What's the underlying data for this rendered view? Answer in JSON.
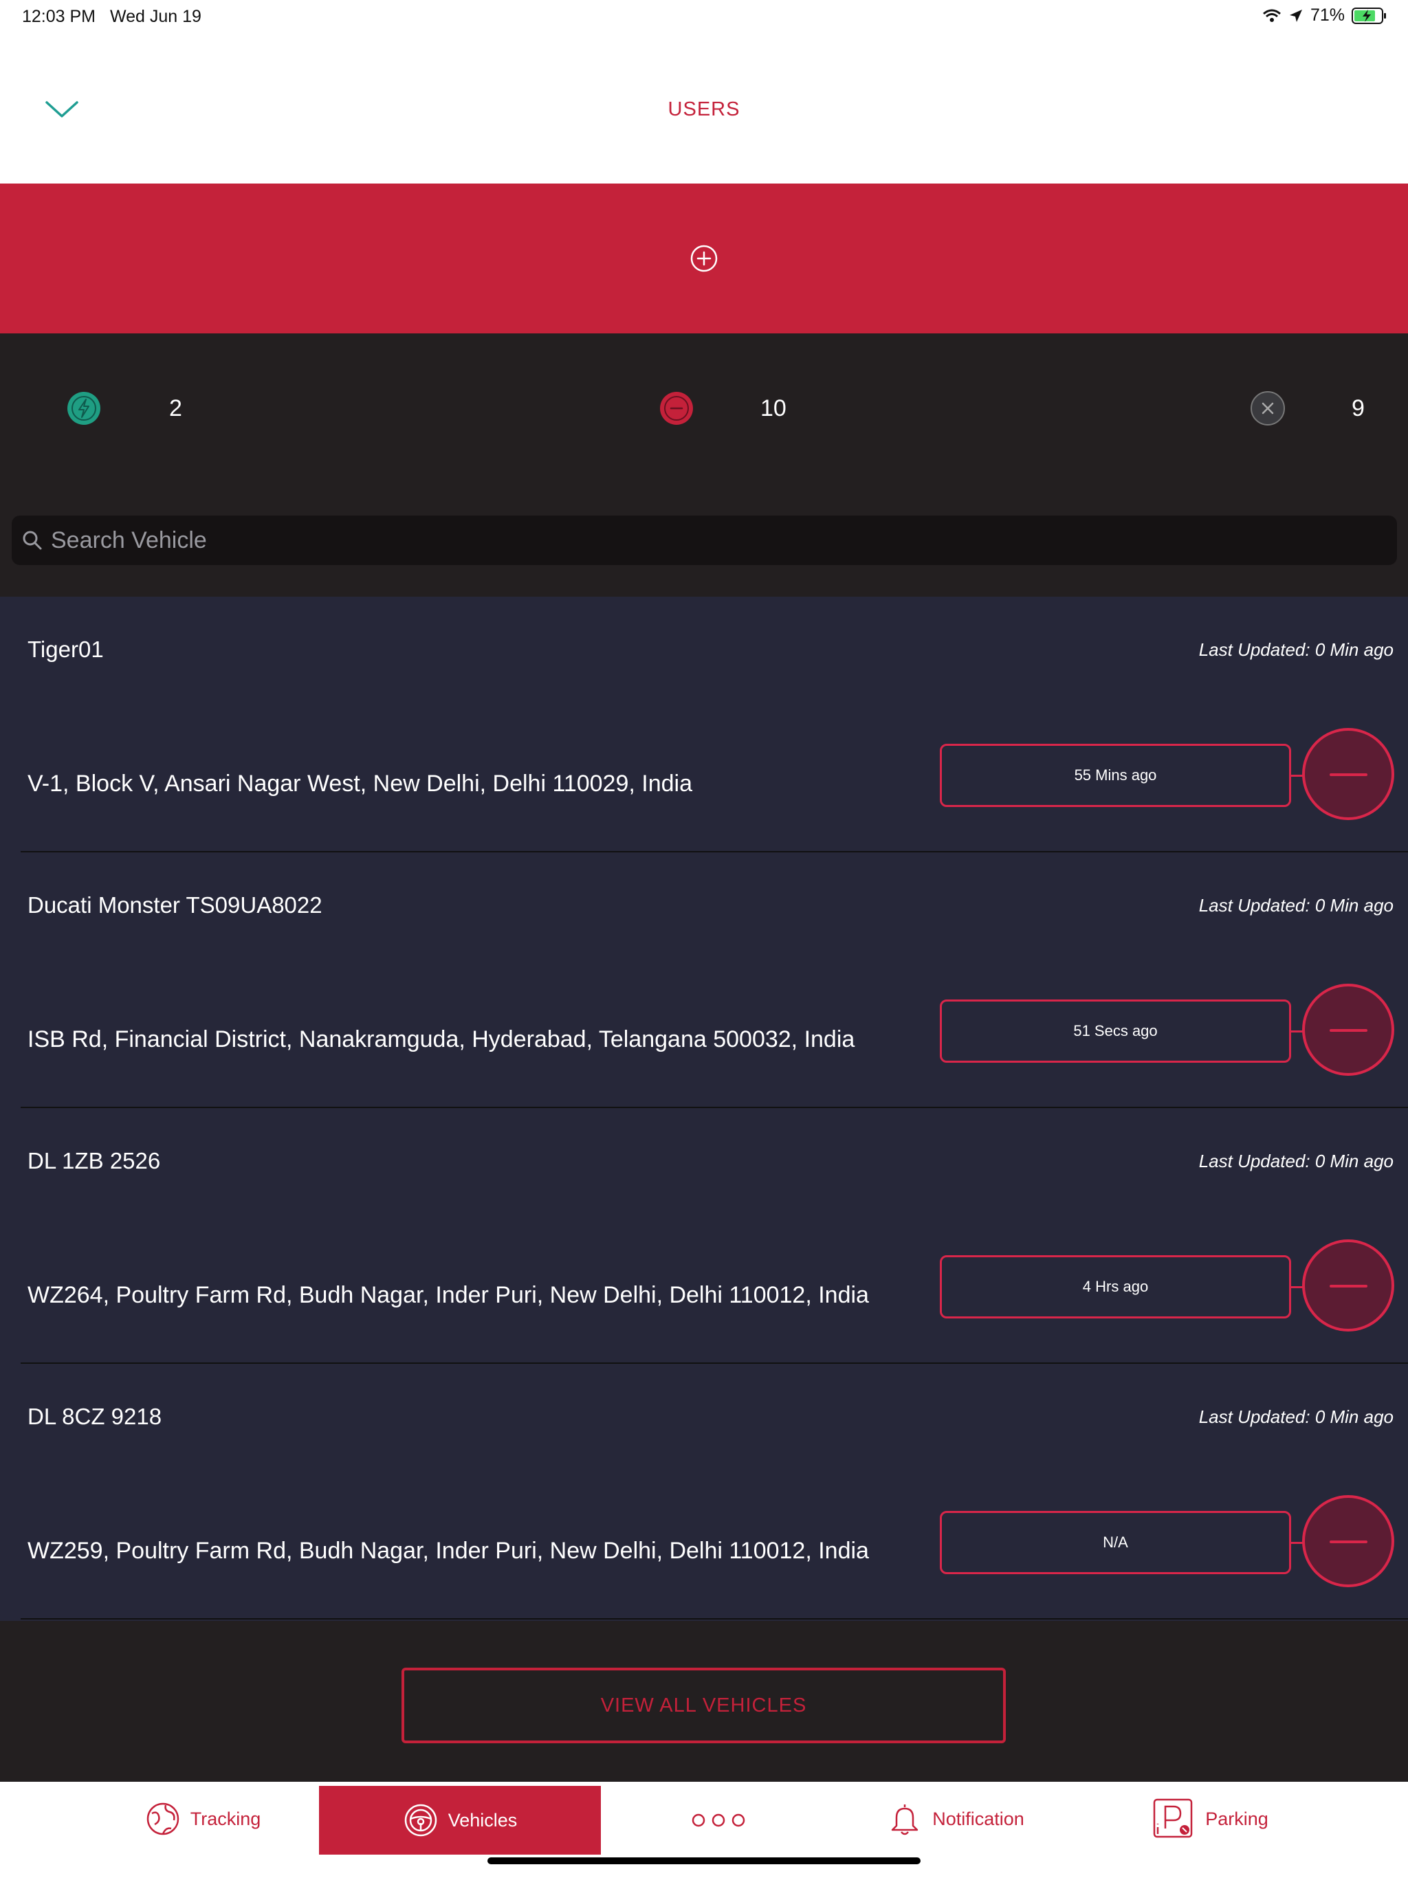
{
  "status_bar": {
    "time": "12:03 PM",
    "date": "Wed Jun 19",
    "battery": "71%"
  },
  "header": {
    "title": "USERS"
  },
  "stats": {
    "active_count": "2",
    "idle_count": "10",
    "offline_count": "9"
  },
  "search": {
    "placeholder": "Search Vehicle"
  },
  "vehicles": [
    {
      "name": "Tiger01",
      "last_updated": "Last Updated: 0 Min ago",
      "address": "V-1, Block V, Ansari Nagar West, New Delhi, Delhi 110029, India",
      "time_ago": "55 Mins ago"
    },
    {
      "name": "Ducati Monster TS09UA8022",
      "last_updated": "Last Updated: 0 Min ago",
      "address": "ISB Rd, Financial District, Nanakramguda, Hyderabad, Telangana 500032, India",
      "time_ago": "51 Secs ago"
    },
    {
      "name": "DL 1ZB 2526",
      "last_updated": "Last Updated: 0 Min ago",
      "address": "WZ264, Poultry Farm Rd, Budh Nagar, Inder Puri, New Delhi, Delhi 110012, India",
      "time_ago": "4 Hrs ago"
    },
    {
      "name": "DL 8CZ 9218",
      "last_updated": "Last Updated: 0 Min ago",
      "address": "WZ259, Poultry Farm Rd, Budh Nagar, Inder Puri, New Delhi, Delhi 110012, India",
      "time_ago": "N/A"
    }
  ],
  "view_all_label": "VIEW ALL VEHICLES",
  "tabs": {
    "tracking": "Tracking",
    "vehicles": "Vehicles",
    "notification": "Notification",
    "parking": "Parking"
  },
  "colors": {
    "accent": "#c4213a",
    "dark_bg": "#231f20",
    "list_bg": "#262739",
    "active_green": "#1f9e83"
  }
}
